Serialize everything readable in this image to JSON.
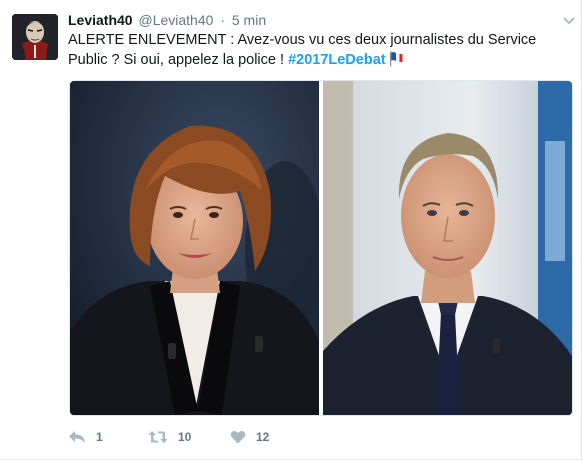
{
  "tweet": {
    "fullname": "Leviath40",
    "handle": "@Leviath40",
    "separator": "·",
    "time": "5 min",
    "text": "ALERTE ENLEVEMENT : Avez-vous vu ces deux journalistes du Service Public ? Si oui, appelez la police ! ",
    "hashtag": "#2017LeDebat",
    "flag_emoji": "flag-france-tricolor",
    "media": {
      "left_photo": "woman-portrait-photo",
      "right_photo": "man-portrait-photo"
    },
    "actions": {
      "reply_count": "1",
      "retweet_count": "10",
      "like_count": "12"
    }
  },
  "colors": {
    "link_blue": "#1da1f2",
    "text_primary": "#14171a",
    "text_secondary": "#657786",
    "border": "#e1e8ed",
    "icon_gray": "#aab8c2"
  },
  "icons": [
    "reply-icon",
    "retweet-icon",
    "heart-icon",
    "chevron-down-icon"
  ]
}
